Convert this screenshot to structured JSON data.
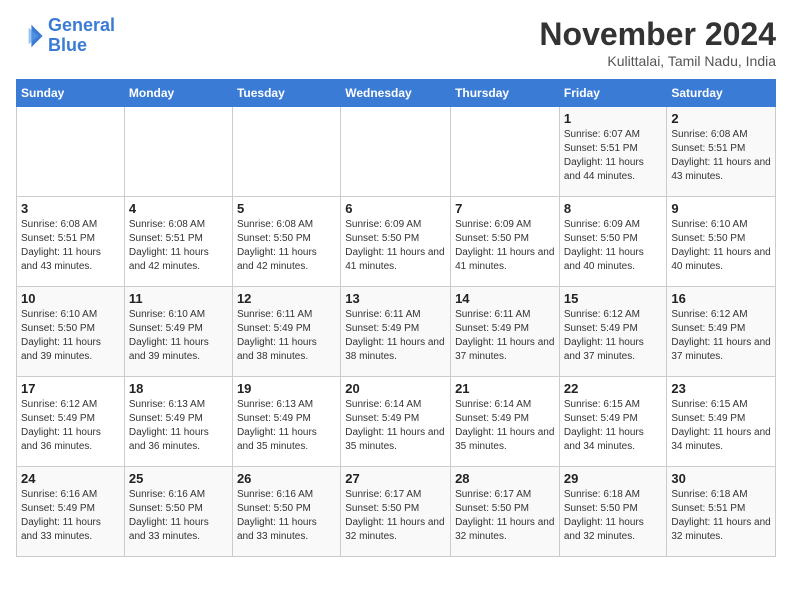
{
  "logo": {
    "line1": "General",
    "line2": "Blue"
  },
  "title": "November 2024",
  "subtitle": "Kulittalai, Tamil Nadu, India",
  "weekdays": [
    "Sunday",
    "Monday",
    "Tuesday",
    "Wednesday",
    "Thursday",
    "Friday",
    "Saturday"
  ],
  "weeks": [
    [
      {
        "day": "",
        "info": ""
      },
      {
        "day": "",
        "info": ""
      },
      {
        "day": "",
        "info": ""
      },
      {
        "day": "",
        "info": ""
      },
      {
        "day": "",
        "info": ""
      },
      {
        "day": "1",
        "info": "Sunrise: 6:07 AM\nSunset: 5:51 PM\nDaylight: 11 hours and 44 minutes."
      },
      {
        "day": "2",
        "info": "Sunrise: 6:08 AM\nSunset: 5:51 PM\nDaylight: 11 hours and 43 minutes."
      }
    ],
    [
      {
        "day": "3",
        "info": "Sunrise: 6:08 AM\nSunset: 5:51 PM\nDaylight: 11 hours and 43 minutes."
      },
      {
        "day": "4",
        "info": "Sunrise: 6:08 AM\nSunset: 5:51 PM\nDaylight: 11 hours and 42 minutes."
      },
      {
        "day": "5",
        "info": "Sunrise: 6:08 AM\nSunset: 5:50 PM\nDaylight: 11 hours and 42 minutes."
      },
      {
        "day": "6",
        "info": "Sunrise: 6:09 AM\nSunset: 5:50 PM\nDaylight: 11 hours and 41 minutes."
      },
      {
        "day": "7",
        "info": "Sunrise: 6:09 AM\nSunset: 5:50 PM\nDaylight: 11 hours and 41 minutes."
      },
      {
        "day": "8",
        "info": "Sunrise: 6:09 AM\nSunset: 5:50 PM\nDaylight: 11 hours and 40 minutes."
      },
      {
        "day": "9",
        "info": "Sunrise: 6:10 AM\nSunset: 5:50 PM\nDaylight: 11 hours and 40 minutes."
      }
    ],
    [
      {
        "day": "10",
        "info": "Sunrise: 6:10 AM\nSunset: 5:50 PM\nDaylight: 11 hours and 39 minutes."
      },
      {
        "day": "11",
        "info": "Sunrise: 6:10 AM\nSunset: 5:49 PM\nDaylight: 11 hours and 39 minutes."
      },
      {
        "day": "12",
        "info": "Sunrise: 6:11 AM\nSunset: 5:49 PM\nDaylight: 11 hours and 38 minutes."
      },
      {
        "day": "13",
        "info": "Sunrise: 6:11 AM\nSunset: 5:49 PM\nDaylight: 11 hours and 38 minutes."
      },
      {
        "day": "14",
        "info": "Sunrise: 6:11 AM\nSunset: 5:49 PM\nDaylight: 11 hours and 37 minutes."
      },
      {
        "day": "15",
        "info": "Sunrise: 6:12 AM\nSunset: 5:49 PM\nDaylight: 11 hours and 37 minutes."
      },
      {
        "day": "16",
        "info": "Sunrise: 6:12 AM\nSunset: 5:49 PM\nDaylight: 11 hours and 37 minutes."
      }
    ],
    [
      {
        "day": "17",
        "info": "Sunrise: 6:12 AM\nSunset: 5:49 PM\nDaylight: 11 hours and 36 minutes."
      },
      {
        "day": "18",
        "info": "Sunrise: 6:13 AM\nSunset: 5:49 PM\nDaylight: 11 hours and 36 minutes."
      },
      {
        "day": "19",
        "info": "Sunrise: 6:13 AM\nSunset: 5:49 PM\nDaylight: 11 hours and 35 minutes."
      },
      {
        "day": "20",
        "info": "Sunrise: 6:14 AM\nSunset: 5:49 PM\nDaylight: 11 hours and 35 minutes."
      },
      {
        "day": "21",
        "info": "Sunrise: 6:14 AM\nSunset: 5:49 PM\nDaylight: 11 hours and 35 minutes."
      },
      {
        "day": "22",
        "info": "Sunrise: 6:15 AM\nSunset: 5:49 PM\nDaylight: 11 hours and 34 minutes."
      },
      {
        "day": "23",
        "info": "Sunrise: 6:15 AM\nSunset: 5:49 PM\nDaylight: 11 hours and 34 minutes."
      }
    ],
    [
      {
        "day": "24",
        "info": "Sunrise: 6:16 AM\nSunset: 5:49 PM\nDaylight: 11 hours and 33 minutes."
      },
      {
        "day": "25",
        "info": "Sunrise: 6:16 AM\nSunset: 5:50 PM\nDaylight: 11 hours and 33 minutes."
      },
      {
        "day": "26",
        "info": "Sunrise: 6:16 AM\nSunset: 5:50 PM\nDaylight: 11 hours and 33 minutes."
      },
      {
        "day": "27",
        "info": "Sunrise: 6:17 AM\nSunset: 5:50 PM\nDaylight: 11 hours and 32 minutes."
      },
      {
        "day": "28",
        "info": "Sunrise: 6:17 AM\nSunset: 5:50 PM\nDaylight: 11 hours and 32 minutes."
      },
      {
        "day": "29",
        "info": "Sunrise: 6:18 AM\nSunset: 5:50 PM\nDaylight: 11 hours and 32 minutes."
      },
      {
        "day": "30",
        "info": "Sunrise: 6:18 AM\nSunset: 5:51 PM\nDaylight: 11 hours and 32 minutes."
      }
    ]
  ]
}
